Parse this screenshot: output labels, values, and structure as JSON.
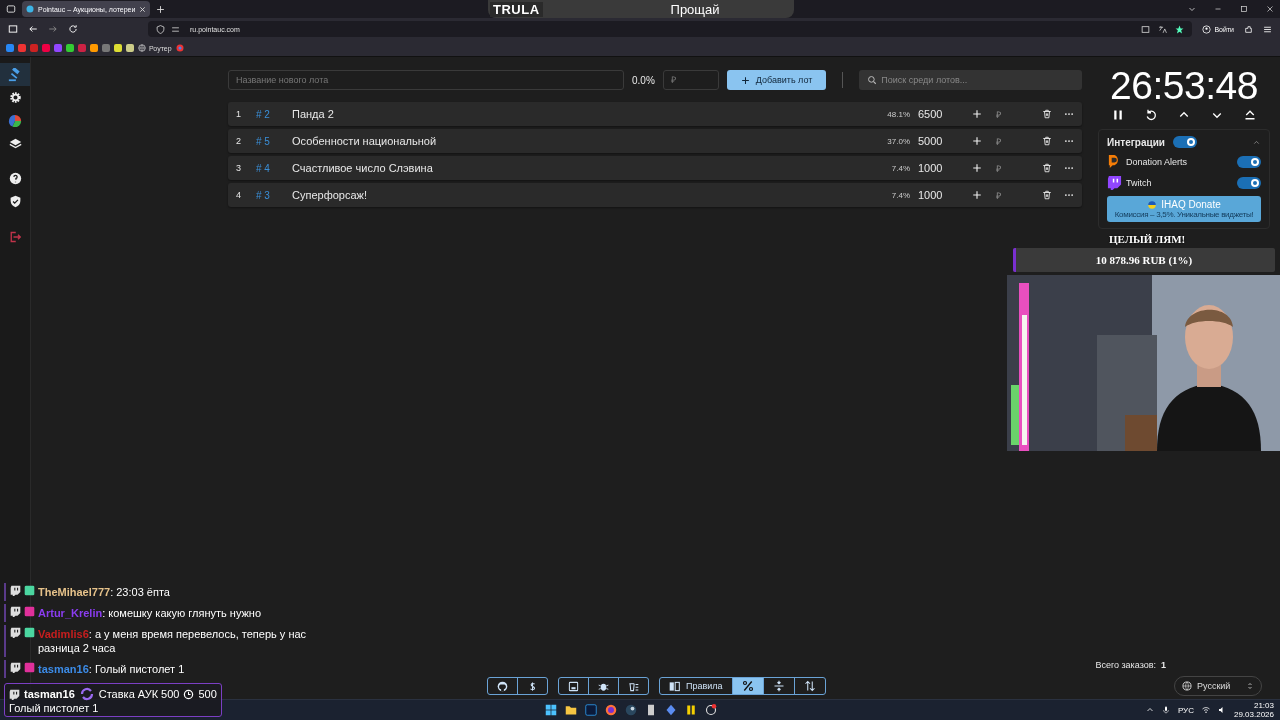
{
  "browser": {
    "tab_title": "Pointauc – Аукционы, лотереи",
    "url": "ru.pointauc.com",
    "bookmark": "Роутер",
    "profile_button": "Войти"
  },
  "stream_banner": {
    "logo": "TRULA",
    "song": "Прощай"
  },
  "sidebar": {
    "items": [
      {
        "kind": "gavel",
        "selected": true
      },
      {
        "kind": "settings",
        "selected": false
      },
      {
        "kind": "pie",
        "selected": false
      },
      {
        "kind": "layers",
        "selected": false
      },
      {
        "kind": "help",
        "selected": false
      },
      {
        "kind": "shield",
        "selected": false
      },
      {
        "kind": "logout",
        "selected": false
      }
    ]
  },
  "new_lot": {
    "placeholder": "Название нового лота",
    "percent": "0.0%",
    "amount_placeholder": "₽",
    "add_button": "Добавить лот"
  },
  "search": {
    "placeholder": "Поиск среди лотов..."
  },
  "lots": [
    {
      "index": "1",
      "id": "# 2",
      "name": "Панда 2",
      "percent": "48.1%",
      "amount": "6500",
      "currency": "₽"
    },
    {
      "index": "2",
      "id": "# 5",
      "name": "Особенности национальной",
      "percent": "37.0%",
      "amount": "5000",
      "currency": "₽"
    },
    {
      "index": "3",
      "id": "# 4",
      "name": "Счастливое число Слэвина",
      "percent": "7.4%",
      "amount": "1000",
      "currency": "₽"
    },
    {
      "index": "4",
      "id": "# 3",
      "name": "Суперфорсаж!",
      "percent": "7.4%",
      "amount": "1000",
      "currency": "₽"
    }
  ],
  "timer": {
    "time": "26:53:48"
  },
  "integrations": {
    "title": "Интеграции",
    "on": true,
    "expanded": true,
    "items": [
      {
        "kind": "donationalerts",
        "name": "Donation Alerts",
        "on": true
      },
      {
        "kind": "twitch",
        "name": "Twitch",
        "on": true
      }
    ],
    "promo": {
      "title": "IHAQ Donate",
      "subtitle": "Комиссия – 3,5%. Уникальные виджеты!"
    }
  },
  "goal": {
    "title": "ЦЕЛЫЙ ЛЯМ!",
    "amount": "10 878.96 RUB (1%)",
    "level": 0.01
  },
  "chat": {
    "messages": [
      {
        "user": "TheMihael777",
        "color": "#e6c28a",
        "text": ": 23:03 ёпта"
      },
      {
        "user": "Artur_Krelin",
        "color": "#8a3cf0",
        "text": ": комешку какую глянуть нужно"
      },
      {
        "user": "Vadimlis6",
        "color": "#c81e1e",
        "text": ": а у меня время перевелось, теперь у нас разница 2 часа"
      },
      {
        "user": "tasman16",
        "color": "#3c8ce8",
        "text": ": Голый пистолет 1"
      }
    ],
    "highlight": {
      "user": "tasman16",
      "label": "Ставка АУК 500",
      "points": "500",
      "text": "Голый пистолет 1"
    }
  },
  "toolbar": {
    "view_buttons": [
      {
        "kind": "rules",
        "label": "Правила",
        "selected": false
      },
      {
        "kind": "percent",
        "selected": true
      },
      {
        "kind": "split",
        "selected": false
      },
      {
        "kind": "sort",
        "selected": false
      }
    ]
  },
  "orders": {
    "label": "Всего заказов:",
    "count": "1"
  },
  "language": "Русский",
  "taskbar": {
    "lang": "РУС",
    "time": "21:03",
    "date": "29.03.2026"
  }
}
